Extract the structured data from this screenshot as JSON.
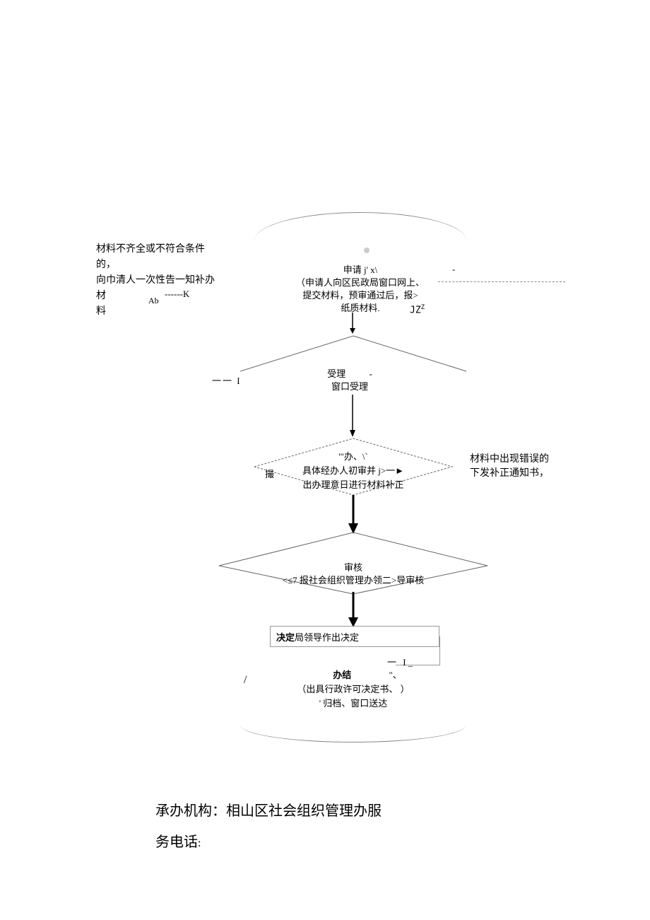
{
  "left_note": {
    "line1": "材料不齐全或不符合条件的，",
    "line2": "向巾清人一次性告一知补办材",
    "line3": "料"
  },
  "ab_label": "Ab",
  "apply": {
    "title": "申请 j' x\\",
    "line2": "（申请人向区民政局窗口网上、",
    "k_label": "------K",
    "line3": "提交材料，预审通过后，报>",
    "line4": "纸质材料.",
    "jz": "JZZ"
  },
  "dash_a": "一一 I",
  "accept": {
    "title": "受理",
    "sub": "窗口受理",
    "tick": "-"
  },
  "ban": {
    "title": "'\"办、\\`",
    "ti": "撮",
    "line2": "具体经办人初审并 j>一►",
    "line3": "出办理意日进行材料补正"
  },
  "right_note": {
    "line1": "材料中出现错误的",
    "line2": "下发补正通知书，"
  },
  "audit": {
    "title": "审核",
    "sub": "<≤7 报社会组织管理办领二>导审核"
  },
  "decide": {
    "bold": "决定",
    "rest": "局领导作出决定"
  },
  "dash_i": "一 I_",
  "end": {
    "slash_l": "/",
    "title": "办结",
    "quote": "\"、",
    "line2": "（出具行政许可决定书、          ）",
    "line3": "'    归档、窗口送达",
    "slash_r": "、"
  },
  "footer": {
    "line1_label": "承办机构：",
    "line1_value": "相山区社会组织管理办服",
    "line2_label": "务电话",
    "colon": ":"
  },
  "tick_mark": "-"
}
